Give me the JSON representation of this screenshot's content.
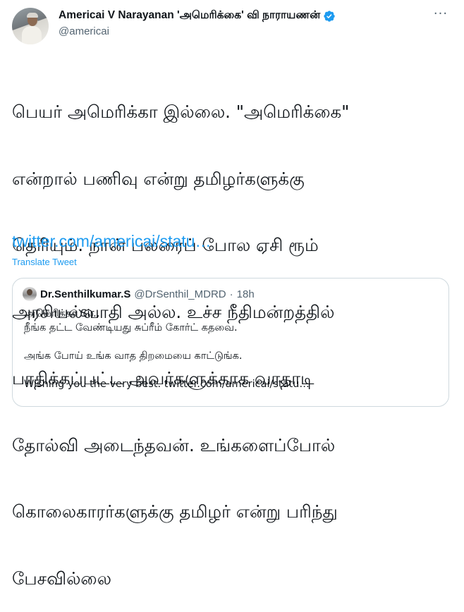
{
  "author": {
    "display_name": "Americai V Narayanan 'அமெரிக்கை' வி நாராயணன்",
    "handle": "@americai",
    "verified_icon": "verified-badge-icon",
    "verified_color": "#1d9bf0"
  },
  "tweet": {
    "text_lines": [
      "பெயர் அமெரிக்கா இல்லை. \"அமெரிக்கை\"",
      "என்றால் பணிவு என்று தமிழர்களுக்கு",
      "தெரியும். நான் பலரைப் போல ஏசி ரூம்",
      "அரசியல்வாதி அல்ல. உச்ச நீதிமன்றத்தில்",
      "பாதிக்கப்பட்ட அவர்களுக்காக வாதாடி",
      "தோல்வி அடைந்தவன். உங்களைப்போல்",
      "கொலைகாரர்களுக்கு தமிழர் என்று பரிந்து",
      "பேசவில்லை"
    ],
    "link": "twitter.com/americai/statu…",
    "translate_label": "Translate Tweet"
  },
  "quoted_tweet": {
    "display_name": "Dr.Senthilkumar.S",
    "handle": "@DrSenthil_MDRD",
    "separator": "·",
    "time": "18h",
    "lines": [
      "அமெரிக்கா Sir.,",
      "நீங்க தட்ட வேண்டியது சுப்ரீம் கோர்ட் கதவை.",
      "",
      "அங்க போய் உங்க வாத திறமையை காட்டுங்க.",
      "",
      "Wishing you the very best. twitter.com/americai/statu…"
    ]
  },
  "colors": {
    "link": "#1d9bf0",
    "text": "#0f1419",
    "secondary": "#536471",
    "border": "#cfd9de"
  }
}
